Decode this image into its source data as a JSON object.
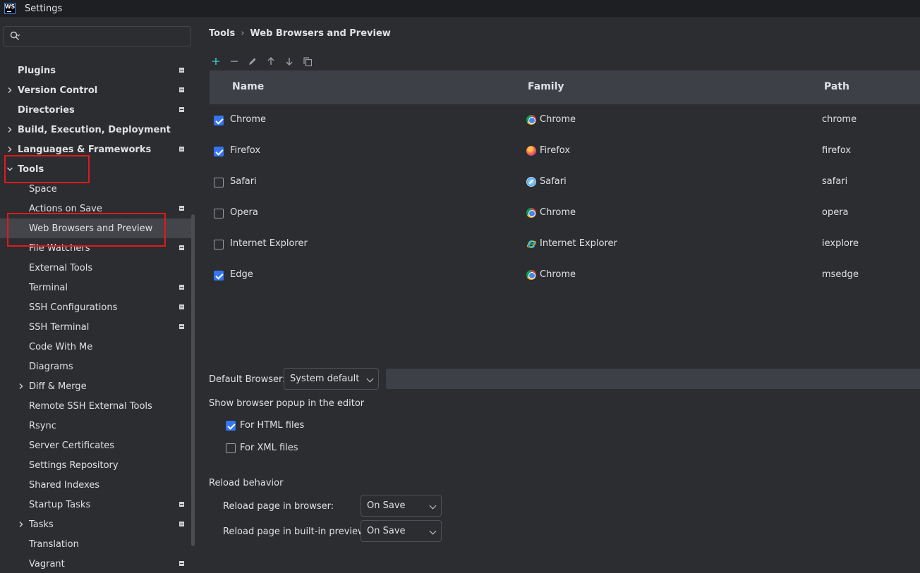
{
  "window": {
    "app_logo_text": "WS",
    "title": "Settings"
  },
  "sidebar": {
    "search_placeholder": "",
    "items": [
      {
        "label": "Plugins",
        "bold": true,
        "arrow": "none",
        "pinned": true
      },
      {
        "label": "Version Control",
        "bold": true,
        "arrow": "collapsed",
        "pinned": true
      },
      {
        "label": "Directories",
        "bold": true,
        "arrow": "none",
        "pinned": true
      },
      {
        "label": "Build, Execution, Deployment",
        "bold": true,
        "arrow": "collapsed",
        "pinned": false
      },
      {
        "label": "Languages & Frameworks",
        "bold": true,
        "arrow": "collapsed",
        "pinned": true
      },
      {
        "label": "Tools",
        "bold": true,
        "arrow": "expanded",
        "pinned": false
      },
      {
        "label": "Space",
        "bold": false,
        "arrow": "none",
        "pinned": false
      },
      {
        "label": "Actions on Save",
        "bold": false,
        "arrow": "none",
        "pinned": true
      },
      {
        "label": "Web Browsers and Preview",
        "bold": false,
        "arrow": "none",
        "pinned": false,
        "selected": true
      },
      {
        "label": "File Watchers",
        "bold": false,
        "arrow": "none",
        "pinned": true
      },
      {
        "label": "External Tools",
        "bold": false,
        "arrow": "none",
        "pinned": false
      },
      {
        "label": "Terminal",
        "bold": false,
        "arrow": "none",
        "pinned": true
      },
      {
        "label": "SSH Configurations",
        "bold": false,
        "arrow": "none",
        "pinned": true
      },
      {
        "label": "SSH Terminal",
        "bold": false,
        "arrow": "none",
        "pinned": true
      },
      {
        "label": "Code With Me",
        "bold": false,
        "arrow": "none",
        "pinned": false
      },
      {
        "label": "Diagrams",
        "bold": false,
        "arrow": "none",
        "pinned": false
      },
      {
        "label": "Diff & Merge",
        "bold": false,
        "arrow": "collapsed",
        "pinned": false
      },
      {
        "label": "Remote SSH External Tools",
        "bold": false,
        "arrow": "none",
        "pinned": false
      },
      {
        "label": "Rsync",
        "bold": false,
        "arrow": "none",
        "pinned": false
      },
      {
        "label": "Server Certificates",
        "bold": false,
        "arrow": "none",
        "pinned": false
      },
      {
        "label": "Settings Repository",
        "bold": false,
        "arrow": "none",
        "pinned": false
      },
      {
        "label": "Shared Indexes",
        "bold": false,
        "arrow": "none",
        "pinned": false
      },
      {
        "label": "Startup Tasks",
        "bold": false,
        "arrow": "none",
        "pinned": true
      },
      {
        "label": "Tasks",
        "bold": false,
        "arrow": "collapsed",
        "pinned": true
      },
      {
        "label": "Translation",
        "bold": false,
        "arrow": "none",
        "pinned": false
      },
      {
        "label": "Vagrant",
        "bold": false,
        "arrow": "none",
        "pinned": true
      }
    ]
  },
  "breadcrumb": {
    "parent": "Tools",
    "separator": "›",
    "current": "Web Browsers and Preview"
  },
  "toolbar": {
    "buttons": [
      "add-icon",
      "remove-icon",
      "edit-icon",
      "move-up-icon",
      "move-down-icon",
      "copy-icon"
    ]
  },
  "table": {
    "headers": {
      "name": "Name",
      "family": "Family",
      "path": "Path"
    },
    "rows": [
      {
        "checked": true,
        "name": "Chrome",
        "family": "Chrome",
        "family_icon": "chrome-icon",
        "path": "chrome"
      },
      {
        "checked": true,
        "name": "Firefox",
        "family": "Firefox",
        "family_icon": "firefox-icon",
        "path": "firefox"
      },
      {
        "checked": false,
        "name": "Safari",
        "family": "Safari",
        "family_icon": "safari-icon",
        "path": "safari"
      },
      {
        "checked": false,
        "name": "Opera",
        "family": "Chrome",
        "family_icon": "chrome-icon",
        "path": "opera"
      },
      {
        "checked": false,
        "name": "Internet Explorer",
        "family": "Internet Explorer",
        "family_icon": "internet-explorer-icon",
        "path": "iexplore"
      },
      {
        "checked": true,
        "name": "Edge",
        "family": "Chrome",
        "family_icon": "chrome-icon",
        "path": "msedge"
      }
    ]
  },
  "default_browser": {
    "label": "Default Browser:",
    "value": "System default",
    "path_value": ""
  },
  "popup": {
    "label": "Show browser popup in the editor",
    "html": {
      "label": "For HTML files",
      "checked": true
    },
    "xml": {
      "label": "For XML files",
      "checked": false
    }
  },
  "reload": {
    "label": "Reload behavior",
    "browser": {
      "label": "Reload page in browser:",
      "value": "On Save"
    },
    "preview": {
      "label": "Reload page in built-in preview:",
      "value": "On Save"
    }
  },
  "colors": {
    "accent": "#3574f0",
    "highlight": "#e0191c",
    "header_bg": "#3d4047",
    "selection_bg": "#43454a"
  }
}
